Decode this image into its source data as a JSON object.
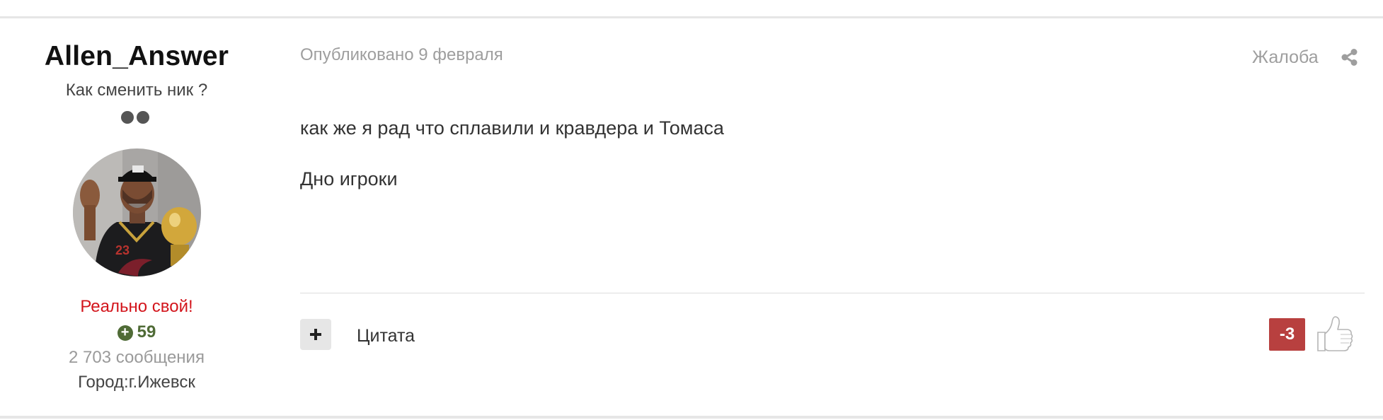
{
  "author": {
    "name": "Allen_Answer",
    "title": "Как сменить ник ?",
    "group": "Реально свой!",
    "reputation": "59",
    "post_count": "2 703 сообщения",
    "city": "Город:г.Ижевск"
  },
  "post": {
    "date": "Опубликовано 9 февраля",
    "report_label": "Жалоба",
    "body": [
      "как же я рад что сплавили и кравдера и Томаса",
      "Дно игроки"
    ],
    "quote_label": "Цитата",
    "reputation_score": "-3"
  },
  "icons": {
    "rank": "rank-dots-icon",
    "reputation": "plus-circle-icon",
    "share": "share-icon",
    "multiquote": "plus-icon",
    "like": "thumbs-up-icon"
  },
  "colors": {
    "group": "#d3151c",
    "reputation": "#4f6b36",
    "negative_badge": "#b8403f"
  }
}
